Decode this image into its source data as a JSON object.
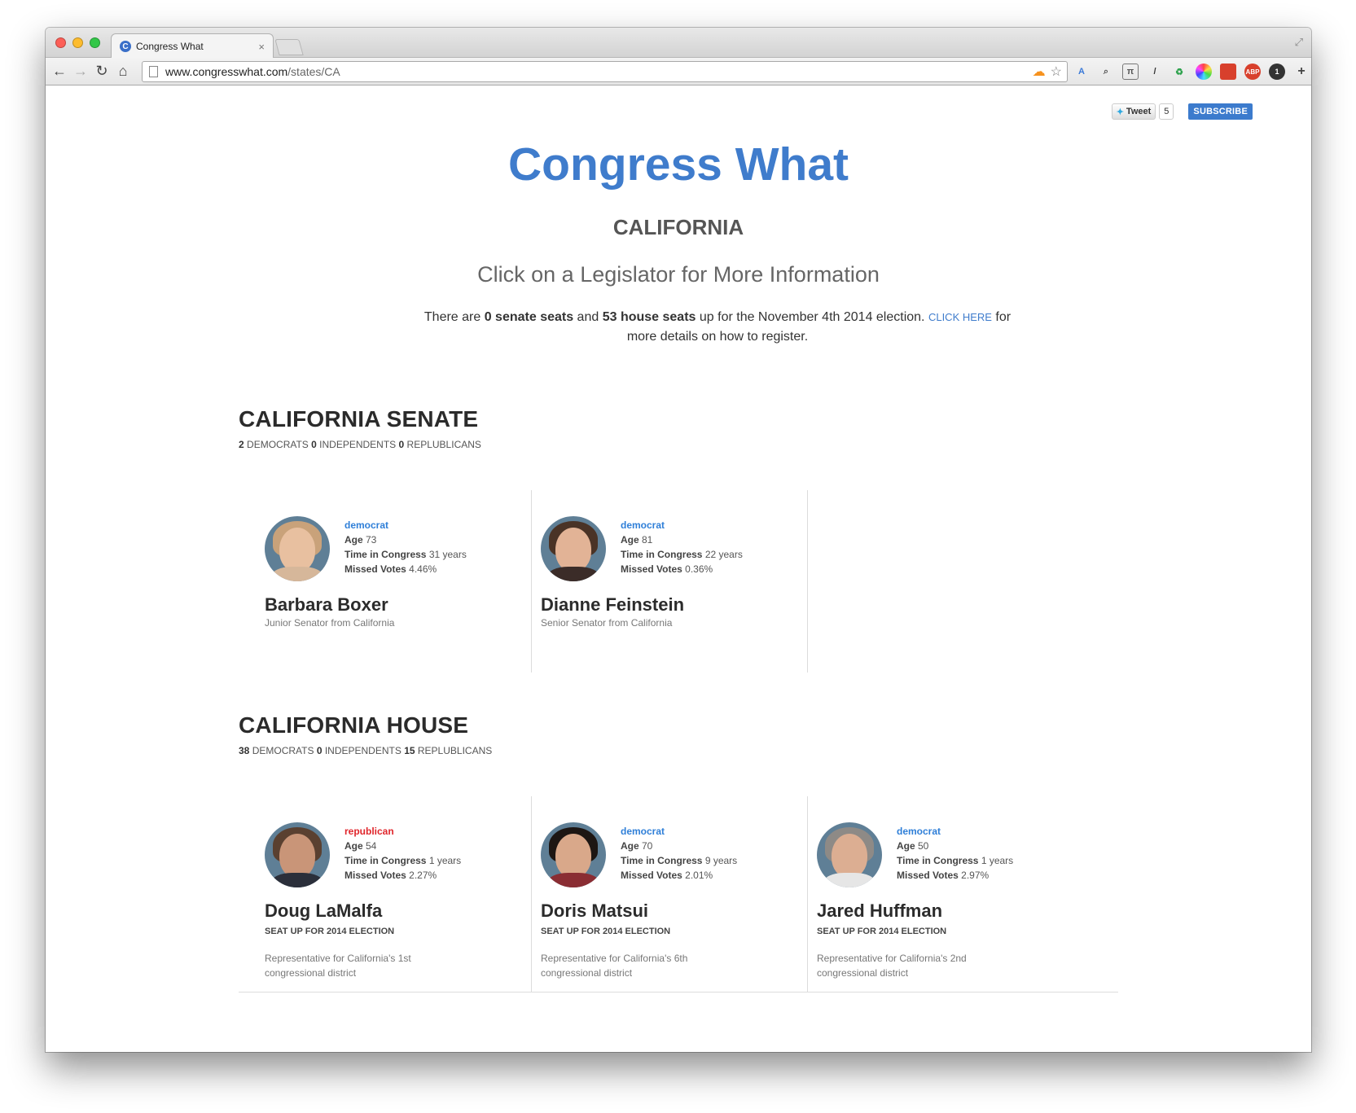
{
  "browser": {
    "tab_title": "Congress What",
    "tab_close": "×",
    "url_host": "www.congresswhat.com",
    "url_path": "/states/CA",
    "extensions": [
      "translate-icon",
      "zoom-icon",
      "pi-icon",
      "eyedropper-icon",
      "recycle-icon",
      "color-wheel-icon",
      "book-icon",
      "abp-icon",
      "counter-icon",
      "crosshair-icon",
      "menu-icon"
    ]
  },
  "social": {
    "tweet_label": "Tweet",
    "tweet_count": "5",
    "subscribe_label": "SUBSCRIBE"
  },
  "header": {
    "site_title": "Congress What",
    "state": "CALIFORNIA",
    "subtitle": "Click on a Legislator for More Information"
  },
  "notice": {
    "prefix": "There are ",
    "senate_seats": "0 senate seats",
    "middle": " and ",
    "house_seats": "53 house seats",
    "after": " up for the November 4th 2014 election. ",
    "link": "CLICK HERE",
    "suffix": " for more details on how to register."
  },
  "senate": {
    "title": "CALIFORNIA SENATE",
    "dem_count": "2",
    "dem_label": " DEMOCRATS ",
    "ind_count": "0",
    "ind_label": " INDEPENDENTS ",
    "rep_count": "0",
    "rep_label": " REPLUBLICANS",
    "members": [
      {
        "party": "democrat",
        "age_label": "Age",
        "age": " 73",
        "time_label": "Time in Congress",
        "time": " 31 years",
        "missed_label": "Missed Votes",
        "missed": " 4.46%",
        "name": "Barbara Boxer",
        "role": "Junior Senator from California"
      },
      {
        "party": "democrat",
        "age_label": "Age",
        "age": " 81",
        "time_label": "Time in Congress",
        "time": " 22 years",
        "missed_label": "Missed Votes",
        "missed": " 0.36%",
        "name": "Dianne Feinstein",
        "role": "Senior Senator from California"
      }
    ]
  },
  "house": {
    "title": "CALIFORNIA HOUSE",
    "dem_count": "38",
    "dem_label": " DEMOCRATS ",
    "ind_count": "0",
    "ind_label": " INDEPENDENTS ",
    "rep_count": "15",
    "rep_label": " REPLUBLICANS",
    "members": [
      {
        "party": "republican",
        "age_label": "Age",
        "age": " 54",
        "time_label": "Time in Congress",
        "time": " 1 years",
        "missed_label": "Missed Votes",
        "missed": " 2.27%",
        "name": "Doug LaMalfa",
        "seat": "SEAT UP FOR 2014 ELECTION",
        "role": "Representative for California's 1st congressional district"
      },
      {
        "party": "democrat",
        "age_label": "Age",
        "age": " 70",
        "time_label": "Time in Congress",
        "time": " 9 years",
        "missed_label": "Missed Votes",
        "missed": " 2.01%",
        "name": "Doris Matsui",
        "seat": "SEAT UP FOR 2014 ELECTION",
        "role": "Representative for California's 6th congressional district"
      },
      {
        "party": "democrat",
        "age_label": "Age",
        "age": " 50",
        "time_label": "Time in Congress",
        "time": " 1 years",
        "missed_label": "Missed Votes",
        "missed": " 2.97%",
        "name": "Jared Huffman",
        "seat": "SEAT UP FOR 2014 ELECTION",
        "role": "Representative for California's 2nd congressional district"
      }
    ]
  },
  "colors": {
    "brand": "#3f7ccc",
    "democrat": "#2f7fd8",
    "republican": "#e0262c"
  }
}
